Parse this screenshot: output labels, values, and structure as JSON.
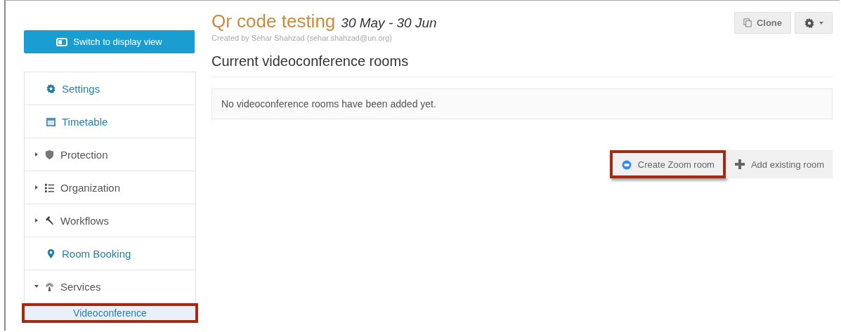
{
  "display_button": {
    "label": "Switch to display view"
  },
  "sidebar": {
    "items": [
      {
        "label": "Settings",
        "kind": "link"
      },
      {
        "label": "Timetable",
        "kind": "link"
      },
      {
        "label": "Protection",
        "kind": "group",
        "expanded": false
      },
      {
        "label": "Organization",
        "kind": "group",
        "expanded": false
      },
      {
        "label": "Workflows",
        "kind": "group",
        "expanded": false
      },
      {
        "label": "Room Booking",
        "kind": "link"
      },
      {
        "label": "Services",
        "kind": "group",
        "expanded": true,
        "children": [
          {
            "label": "Videoconference",
            "selected": true,
            "highlighted": true
          }
        ]
      }
    ]
  },
  "event": {
    "title": "Qr code testing",
    "dates": "30 May - 30 Jun",
    "created_by": "Created by Sehar Shahzad (sehar.shahzad@un.org)"
  },
  "toolbar": {
    "clone_label": "Clone"
  },
  "section": {
    "heading": "Current videoconference rooms",
    "empty_message": "No videoconference rooms have been added yet."
  },
  "actions": [
    {
      "label": "Create Zoom room",
      "kind": "zoom",
      "highlighted": true
    },
    {
      "label": "Add existing room",
      "kind": "add",
      "highlighted": false
    }
  ]
}
